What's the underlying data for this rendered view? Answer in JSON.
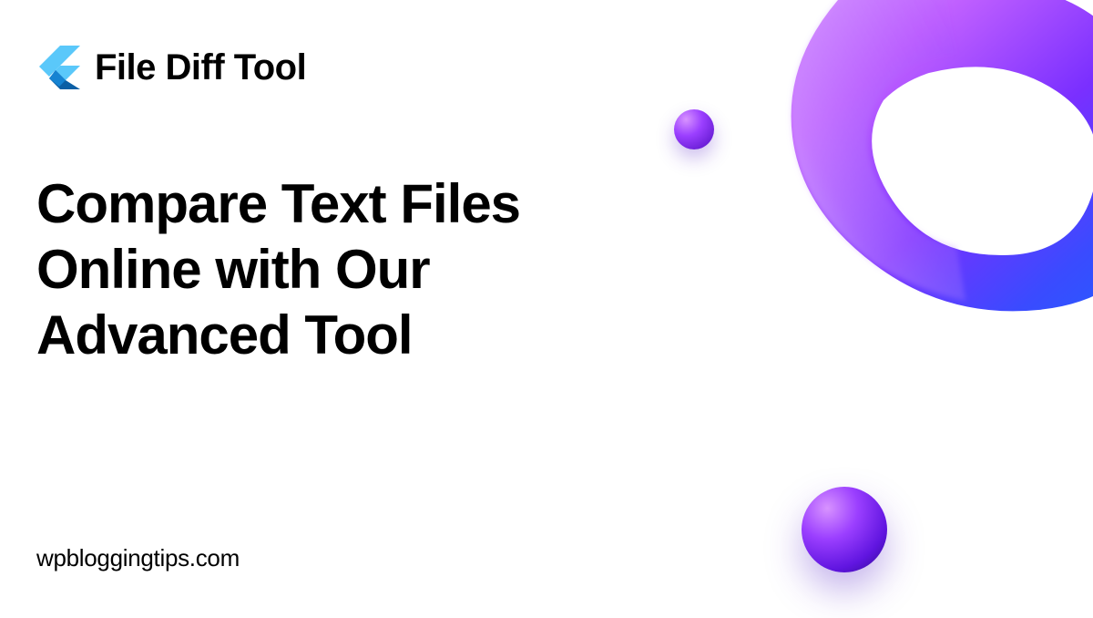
{
  "brand": {
    "name": "File Diff Tool"
  },
  "headline": "Compare Text Files Online with Our Advanced Tool",
  "domain": "wpbloggingtips.com",
  "colors": {
    "gradient_start": "#d893ff",
    "gradient_mid": "#9b3fff",
    "gradient_end": "#2a0a8a",
    "logo_light": "#5AC8FA",
    "logo_dark": "#0B5FA5"
  }
}
